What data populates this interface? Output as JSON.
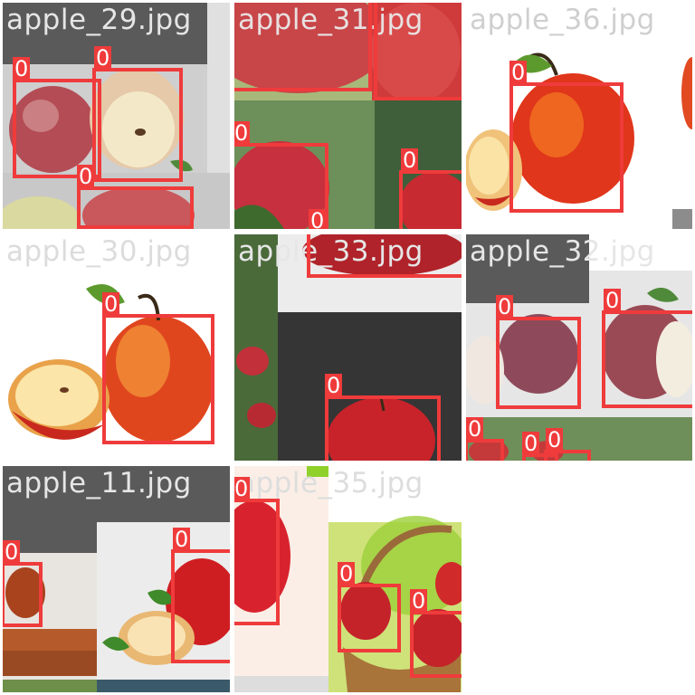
{
  "colors": {
    "box": "#ef3b3b",
    "label_text": "#ffffff",
    "filename_light": "#cfcfcf",
    "filename_dark": "#e6e6e6",
    "banner": "#5a5a5a"
  },
  "tiles": [
    {
      "filename": "apple_29.jpg",
      "detections": [
        {
          "label": "0"
        },
        {
          "label": "0"
        },
        {
          "label": "0"
        }
      ]
    },
    {
      "filename": "apple_31.jpg",
      "detections": [
        {
          "label": "0"
        },
        {
          "label": "0"
        },
        {
          "label": "0"
        },
        {
          "label": "0"
        }
      ]
    },
    {
      "filename": "apple_36.jpg",
      "detections": [
        {
          "label": "0"
        }
      ]
    },
    {
      "filename": "apple_30.jpg",
      "detections": [
        {
          "label": "0"
        }
      ]
    },
    {
      "filename": "apple_33.jpg",
      "detections": [
        {
          "label": "0"
        },
        {
          "label": "0"
        }
      ]
    },
    {
      "filename": "apple_32.jpg",
      "detections": [
        {
          "label": "0"
        },
        {
          "label": "0"
        },
        {
          "label": "0"
        },
        {
          "label": "0"
        },
        {
          "label": "0"
        },
        {
          "label": "0"
        }
      ]
    },
    {
      "filename": "apple_11.jpg",
      "detections": [
        {
          "label": "0"
        },
        {
          "label": "0"
        }
      ]
    },
    {
      "filename": "apple_35.jpg",
      "detections": [
        {
          "label": "0"
        },
        {
          "label": "0"
        },
        {
          "label": "0"
        }
      ]
    }
  ]
}
